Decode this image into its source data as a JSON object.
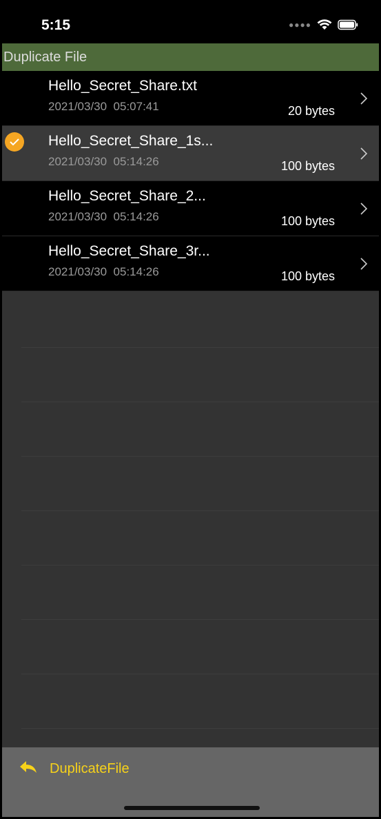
{
  "status": {
    "time": "5:15"
  },
  "header": {
    "title": "Duplicate File"
  },
  "files": [
    {
      "name": "Hello_Secret_Share.txt",
      "date": "2021/03/30  05:07:41",
      "size": "20 bytes",
      "selected": false
    },
    {
      "name": "Hello_Secret_Share_1s...",
      "date": "2021/03/30  05:14:26",
      "size": "100 bytes",
      "selected": true
    },
    {
      "name": "Hello_Secret_Share_2...",
      "date": "2021/03/30  05:14:26",
      "size": "100 bytes",
      "selected": false
    },
    {
      "name": "Hello_Secret_Share_3r...",
      "date": "2021/03/30  05:14:26",
      "size": "100 bytes",
      "selected": false
    }
  ],
  "toolbar": {
    "back_label": "DuplicateFile"
  },
  "colors": {
    "accent": "#f7d21a",
    "header": "#4e6a3a",
    "check": "#f5a623"
  },
  "icons": {
    "back": "back-arrow-icon",
    "chevron": "chevron-right-icon",
    "check": "checkmark-circle-icon"
  }
}
